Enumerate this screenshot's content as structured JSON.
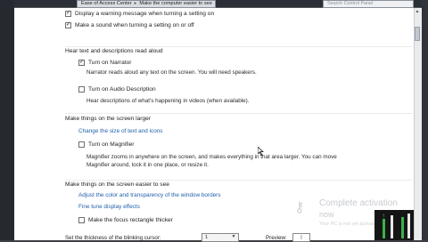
{
  "window": {
    "breadcrumb_items": [
      "Ease of Access Center",
      "Make the computer easier to see"
    ],
    "search_placeholder": "Search Control Panel"
  },
  "top_checks": [
    {
      "label": "Display a warning message when turning a setting on",
      "checked": true
    },
    {
      "label": "Make a sound when turning a setting on or off",
      "checked": true
    }
  ],
  "section_hear": {
    "heading": "Hear text and descriptions read aloud",
    "narrator": {
      "label": "Turn on Narrator",
      "checked": true,
      "desc": "Narrator reads aloud any text on the screen. You will need speakers."
    },
    "audio": {
      "label": "Turn on Audio Description",
      "checked": false,
      "desc": "Hear descriptions of what's happening in videos (when available)."
    }
  },
  "section_larger": {
    "heading": "Make things on the screen larger",
    "link": "Change the size of text and icons",
    "magnifier": {
      "label": "Turn on Magnifier",
      "checked": false,
      "desc1": "Magnifier zooms in anywhere on the screen, and makes everything in that area larger. You can move",
      "desc2": "Magnifier around, lock it in one place, or resize it."
    }
  },
  "section_see": {
    "heading": "Make things on the screen easier to see",
    "link1": "Adjust the color and transparency of the window borders",
    "link2": "Fine tune display effects",
    "focus": {
      "label": "Make the focus rectangle thicker",
      "checked": false
    },
    "bottom_label": "Set the thickness of the blinking cursor:",
    "combo_value": "1",
    "preview_label": "Preview:",
    "preview_value": "|"
  },
  "watermark": {
    "title": "Complete activation",
    "subtitle": "now",
    "small": "Your PC is not yet activated"
  },
  "colors": {
    "link": "#1f5fad",
    "tray_green": "#3db04a"
  }
}
